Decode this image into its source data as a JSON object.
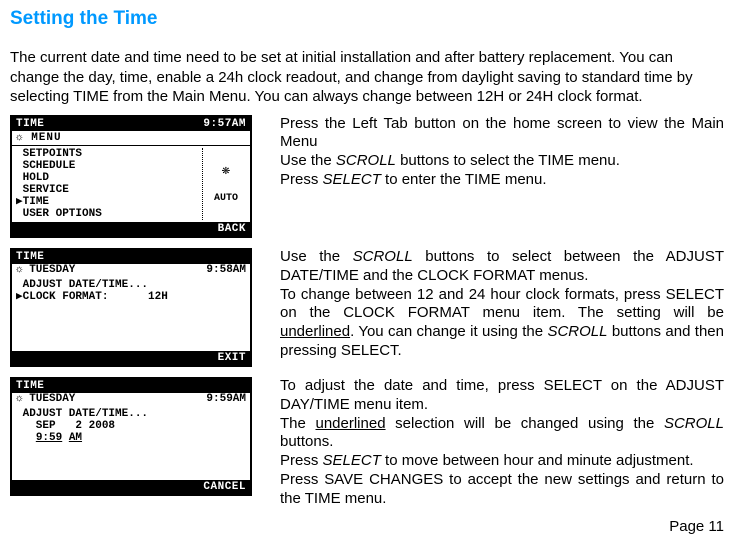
{
  "title": "Setting the Time",
  "intro": "The current date and time need to be set at initial installation and after battery replacement. You can change the day, time, enable a 24h clock readout, and change from daylight saving to standard time by selecting TIME from the Main Menu.  You can always change between 12H or 24H clock format.",
  "lcd1": {
    "top_left": "TIME",
    "top_right": "9:57AM",
    "header_left": "☼   MENU",
    "items": {
      "a": " SETPOINTS",
      "b": " SCHEDULE",
      "c": " HOLD",
      "d": " SERVICE",
      "e": "▶TIME",
      "f": " USER OPTIONS"
    },
    "side_top": "❋",
    "side_bot": "AUTO",
    "bot_left": "",
    "bot_right": "BACK"
  },
  "desc1": {
    "a": "Press the Left Tab button on the home screen to view the Main Menu",
    "b_pre": "Use the ",
    "b_it": "SCROLL",
    "b_post": " buttons to select the TIME menu.",
    "c_pre": "Press ",
    "c_it": "SELECT",
    "c_post": " to enter the TIME menu."
  },
  "lcd2": {
    "top_left": "TIME",
    "top_right": "",
    "sub_left": "☼  TUESDAY",
    "sub_right": "9:58AM",
    "items": {
      "a": " ADJUST DATE/TIME...",
      "b": "▶CLOCK FORMAT:      12H"
    },
    "bot_left": "",
    "bot_right": "EXIT"
  },
  "desc2": {
    "a_pre": "Use the ",
    "a_it": "SCROLL",
    "a_post": " buttons to select between the ADJUST DATE/TIME and the CLOCK FORMAT menus.",
    "b": "To change between 12 and 24 hour clock formats, press SELECT on the CLOCK FORMAT menu item. The setting will be ",
    "b_ul": "underlined",
    "b_post": ". You can change it using the ",
    "b_it": "SCROLL",
    "b_end": " buttons and then pressing SELECT."
  },
  "lcd3": {
    "top_left": "TIME",
    "top_right": "",
    "sub_left": "☼  TUESDAY",
    "sub_right": "9:59AM",
    "items": {
      "a": " ADJUST DATE/TIME...",
      "b": "   SEP   2 2008",
      "c_pre": "   ",
      "c_ul": "9:59",
      "c_ul2": "AM"
    },
    "bot_left": "",
    "bot_right": "CANCEL"
  },
  "desc3": {
    "a": "To adjust the date and time, press SELECT on the ADJUST DAY/TIME menu item.",
    "b_pre": "The ",
    "b_ul": "underlined",
    "b_mid": " selection will be changed using the  ",
    "b_it": "SCROLL",
    "b_post": " buttons.",
    "c_pre": "Press ",
    "c_it": "SELECT",
    "c_post": " to move between hour and minute adjustment.",
    "d": "Press SAVE CHANGES to accept the new settings and return to the TIME menu."
  },
  "page": "Page 11"
}
